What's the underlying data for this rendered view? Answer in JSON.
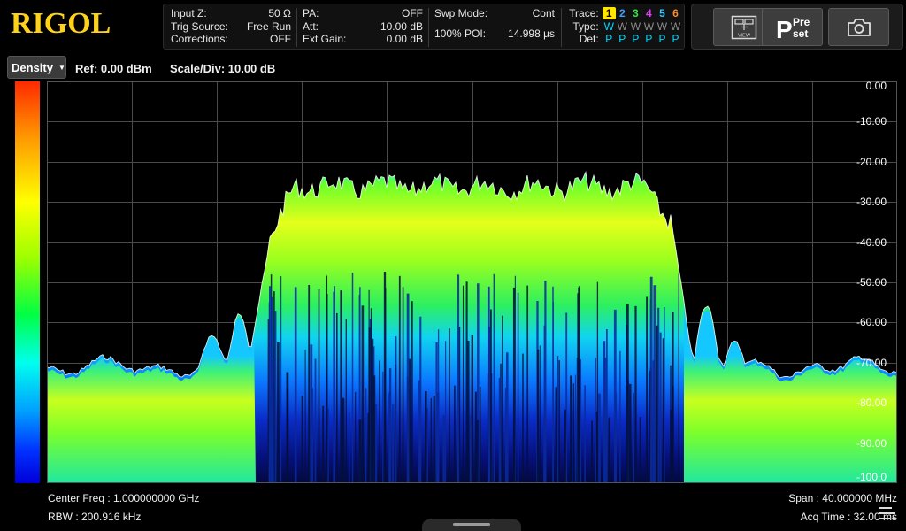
{
  "brand": {
    "logo": "RIGOL"
  },
  "status": {
    "group1": [
      {
        "k": "Input Z:",
        "v": "50 Ω"
      },
      {
        "k": "Trig Source:",
        "v": "Free Run"
      },
      {
        "k": "Corrections:",
        "v": "OFF"
      }
    ],
    "group2": [
      {
        "k": "PA:",
        "v": "OFF"
      },
      {
        "k": "Att:",
        "v": "10.00 dB"
      },
      {
        "k": "Ext Gain:",
        "v": "0.00 dB"
      }
    ],
    "group3": [
      {
        "k": "Swp Mode:",
        "v": "Cont"
      },
      {
        "k": "100% POI:",
        "v": "14.998 µs"
      }
    ]
  },
  "traces": {
    "trace_label": "Trace:",
    "type_label": "Type:",
    "det_label": "Det:",
    "numbers": [
      "1",
      "2",
      "3",
      "4",
      "5",
      "6"
    ],
    "colors": [
      "#000000",
      "#3aa0ff",
      "#2ee83a",
      "#e040ff",
      "#33c8ff",
      "#ff8a2a"
    ],
    "types": [
      "W",
      "W",
      "W",
      "W",
      "W",
      "W"
    ],
    "dets": [
      "P",
      "P",
      "P",
      "P",
      "P",
      "P"
    ],
    "selected": 0
  },
  "toolbar": {
    "view_label": "VIEW",
    "preset_top": "Pre",
    "preset_bottom": "set"
  },
  "display": {
    "mode": "Density",
    "ref": "Ref: 0.00 dBm",
    "scale": "Scale/Div: 10.00 dB"
  },
  "y_axis": [
    "0.00",
    "-10.00",
    "-20.00",
    "-30.00",
    "-40.00",
    "-50.00",
    "-60.00",
    "-70.00",
    "-80.00",
    "-90.00",
    "-100.0"
  ],
  "footer": {
    "center": "Center Freq : 1.000000000 GHz",
    "rbw": "RBW : 200.916 kHz",
    "span": "Span : 40.000000 MHz",
    "acq": "Acq Time : 32.00 ms"
  }
}
